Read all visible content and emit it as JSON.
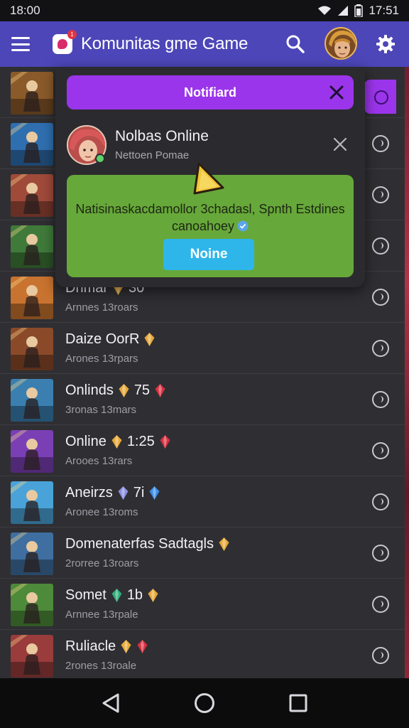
{
  "status_bar": {
    "time_left": "18:00",
    "time_right": "17:51"
  },
  "app_bar": {
    "title": "Komunitas gme Game",
    "logo_badge": "1"
  },
  "notification": {
    "header_label": "Notifiard",
    "sender_name": "Nolbas Online",
    "sender_subtitle": "Nettoen Pomae",
    "message": "Natisinaskacdamollor 3chadasl, Spnth Estdines canoahoey",
    "confirm_label": "Noine"
  },
  "games": [
    {
      "title": "Dnmar",
      "badge": "30",
      "subtitle": "Arnnes 13roars",
      "thumb_color": "#c8732f",
      "gem_colors": [
        "#e8a93a"
      ]
    },
    {
      "title": "Daize OorR",
      "badge": "",
      "subtitle": "Arones 13rpars",
      "thumb_color": "#8a4a2a",
      "gem_colors": [
        "#e8a93a"
      ]
    },
    {
      "title": "Onlinds",
      "badge": "75",
      "subtitle": "3ronas 13mars",
      "thumb_color": "#3a7fb0",
      "gem_colors": [
        "#e8a93a",
        "#d93040"
      ]
    },
    {
      "title": "Online",
      "badge": "1:25",
      "subtitle": "Arooes 13rars",
      "thumb_color": "#7b3fb5",
      "gem_colors": [
        "#e8a93a",
        "#d93040"
      ]
    },
    {
      "title": "Aneirzs",
      "badge": "7i",
      "subtitle": "Aronee 13roms",
      "thumb_color": "#4aa3d8",
      "gem_colors": [
        "#8b8fe0",
        "#3d8ee8"
      ]
    },
    {
      "title": "Domenaterfas Sadtagls",
      "badge": "",
      "subtitle": "2rorree 13roars",
      "thumb_color": "#3f6fa0",
      "gem_colors": [
        "#e8a93a"
      ]
    },
    {
      "title": "Somet",
      "badge": "1b",
      "subtitle": "Arnnee 13rpale",
      "thumb_color": "#4d8a3a",
      "gem_colors": [
        "#2fae7a",
        "#e8a93a"
      ]
    },
    {
      "title": "Ruliacle",
      "badge": "",
      "subtitle": "2rones 13roale",
      "thumb_color": "#9a3c3c",
      "gem_colors": [
        "#e8a93a",
        "#d93040"
      ]
    }
  ],
  "hidden_top_thumbs": [
    {
      "thumb_color": "#8a5a2a"
    },
    {
      "thumb_color": "#2f6fb0"
    },
    {
      "thumb_color": "#a04a3a"
    },
    {
      "thumb_color": "#3f7a3a"
    }
  ],
  "colors": {
    "app_bar": "#4c46b8",
    "notif_header": "#9b35eb",
    "message_box": "#67a83a",
    "confirm_button": "#2eb6ea"
  },
  "icons": {
    "menu": "hamburger-menu-icon",
    "search": "search-icon",
    "settings": "gear-icon",
    "close": "close-icon",
    "alert": "warning-triangle-icon",
    "verify": "verified-check-icon",
    "nav_back": "back-triangle-icon",
    "nav_home": "home-circle-icon",
    "nav_recents": "recents-square-icon"
  }
}
